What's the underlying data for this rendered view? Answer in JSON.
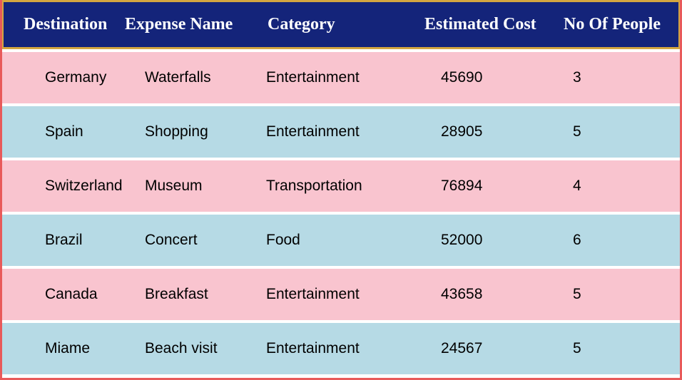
{
  "chart_data": {
    "type": "table",
    "columns": [
      "Destination",
      "Expense Name",
      "Category",
      "Estimated Cost",
      "No Of People"
    ],
    "rows": [
      [
        "Germany",
        "Waterfalls",
        "Entertainment",
        45690,
        3
      ],
      [
        "Spain",
        "Shopping",
        "Entertainment",
        28905,
        5
      ],
      [
        "Switzerland",
        "Museum",
        "Transportation",
        76894,
        4
      ],
      [
        "Brazil",
        "Concert",
        "Food",
        52000,
        6
      ],
      [
        "Canada",
        "Breakfast",
        "Entertainment",
        43658,
        5
      ],
      [
        "Miame",
        "Beach visit",
        "Entertainment",
        24567,
        5
      ]
    ]
  },
  "headers": {
    "dest": "Destination",
    "exp": "Expense Name",
    "cat": "Category",
    "cost": "Estimated Cost",
    "people": "No Of People"
  },
  "rows": [
    {
      "dest": "Germany",
      "exp": "Waterfalls",
      "cat": "Entertainment",
      "cost": "45690",
      "people": "3"
    },
    {
      "dest": "Spain",
      "exp": "Shopping",
      "cat": "Entertainment",
      "cost": "28905",
      "people": "5"
    },
    {
      "dest": "Switzerland",
      "exp": "Museum",
      "cat": "Transportation",
      "cost": "76894",
      "people": "4"
    },
    {
      "dest": "Brazil",
      "exp": "Concert",
      "cat": "Food",
      "cost": "52000",
      "people": "6"
    },
    {
      "dest": "Canada",
      "exp": "Breakfast",
      "cat": "Entertainment",
      "cost": "43658",
      "people": "5"
    },
    {
      "dest": "Miame",
      "exp": "Beach visit",
      "cat": "Entertainment",
      "cost": "24567",
      "people": "5"
    }
  ]
}
